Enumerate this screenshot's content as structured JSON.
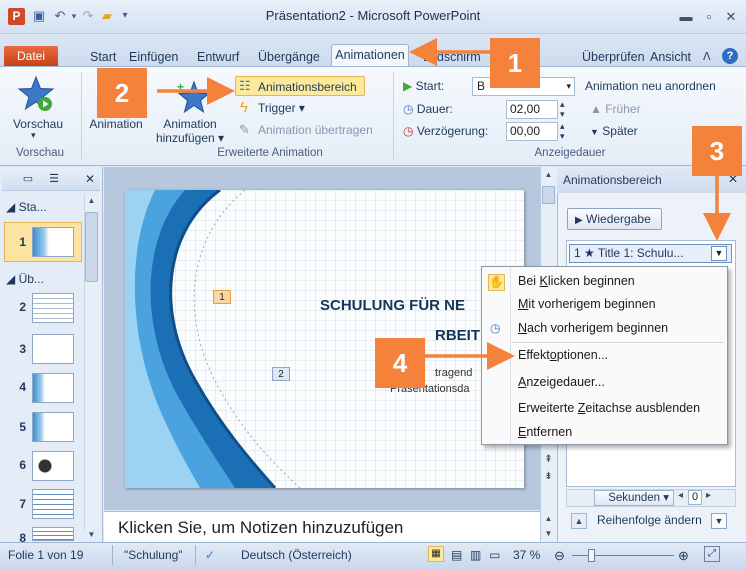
{
  "window": {
    "title": "Präsentation2 - Microsoft PowerPoint",
    "app_letter": "P"
  },
  "tabs": [
    {
      "id": "datei",
      "label": "Datei"
    },
    {
      "id": "start",
      "label": "Start"
    },
    {
      "id": "einfuegen",
      "label": "Einfügen"
    },
    {
      "id": "entwurf",
      "label": "Entwurf"
    },
    {
      "id": "uebergaenge",
      "label": "Übergänge"
    },
    {
      "id": "animationen",
      "label": "Animationen"
    },
    {
      "id": "bildschirm",
      "label": "Bildschirm"
    },
    {
      "id": "ueberpruefen",
      "label": "Überprüfen"
    },
    {
      "id": "ansicht",
      "label": "Ansicht"
    }
  ],
  "ribbon": {
    "vorschau": {
      "button": "Vorschau",
      "group": "Vorschau"
    },
    "animation_label": "Animation",
    "erweiterte": {
      "add_line1": "Animation",
      "add_line2": "hinzufügen",
      "animationsbereich": "Animationsbereich",
      "trigger": "Trigger",
      "uebertragen": "Animation übertragen",
      "group": "Erweiterte Animation"
    },
    "timing": {
      "start_label": "Start:",
      "start_value": "B",
      "dauer_label": "Dauer:",
      "dauer_value": "02,00",
      "verzoegerung_label": "Verzögerung:",
      "verzoegerung_value": "00,00",
      "reorder_title": "Animation neu anordnen",
      "frueher": "Früher",
      "spaeter": "Später",
      "group": "Anzeigedauer"
    }
  },
  "left_pane": {
    "sections": [
      "Sta...",
      "Üb..."
    ],
    "slides": [
      "1",
      "2",
      "3",
      "4",
      "5",
      "6",
      "7",
      "8"
    ]
  },
  "slide": {
    "title_line1": "SCHULUNG FÜR NE",
    "title_line2": "RBEIT",
    "sub_line1": "tragend",
    "sub_line2": "Präsentationsda",
    "anim_tag_1": "1",
    "anim_tag_2": "2"
  },
  "notes": {
    "placeholder": "Klicken Sie, um Notizen hinzuzufügen"
  },
  "anim_pane": {
    "title": "Animationsbereich",
    "play_label": "Wiedergabe",
    "item_label": "1 ★ Title 1: Schulu...",
    "seconds_label": "Sekunden",
    "seconds_value": "0",
    "reorder_label": "Reihenfolge ändern"
  },
  "context_menu": {
    "items": [
      {
        "pre": "Bei ",
        "key": "K",
        "post": "licken beginnen"
      },
      {
        "pre": "",
        "key": "M",
        "post": "it vorherigem beginnen"
      },
      {
        "pre": "",
        "key": "N",
        "post": "ach vorherigem beginnen"
      },
      {
        "pre": "Effekt",
        "key": "o",
        "post": "ptionen..."
      },
      {
        "pre": "",
        "key": "A",
        "post": "nzeigedauer..."
      },
      {
        "pre": "Erweiterte ",
        "key": "Z",
        "post": "eitachse ausblenden"
      },
      {
        "pre": "",
        "key": "E",
        "post": "ntfernen"
      }
    ]
  },
  "status_bar": {
    "slide_info": "Folie 1 von 19",
    "theme": "\"Schulung\"",
    "language": "Deutsch (Österreich)",
    "zoom": "37 %"
  },
  "callouts": [
    "1",
    "2",
    "3",
    "4"
  ],
  "colors": {
    "callout": "#f5823a",
    "datei_tab": "#d24726",
    "highlight": "#fde99a"
  }
}
